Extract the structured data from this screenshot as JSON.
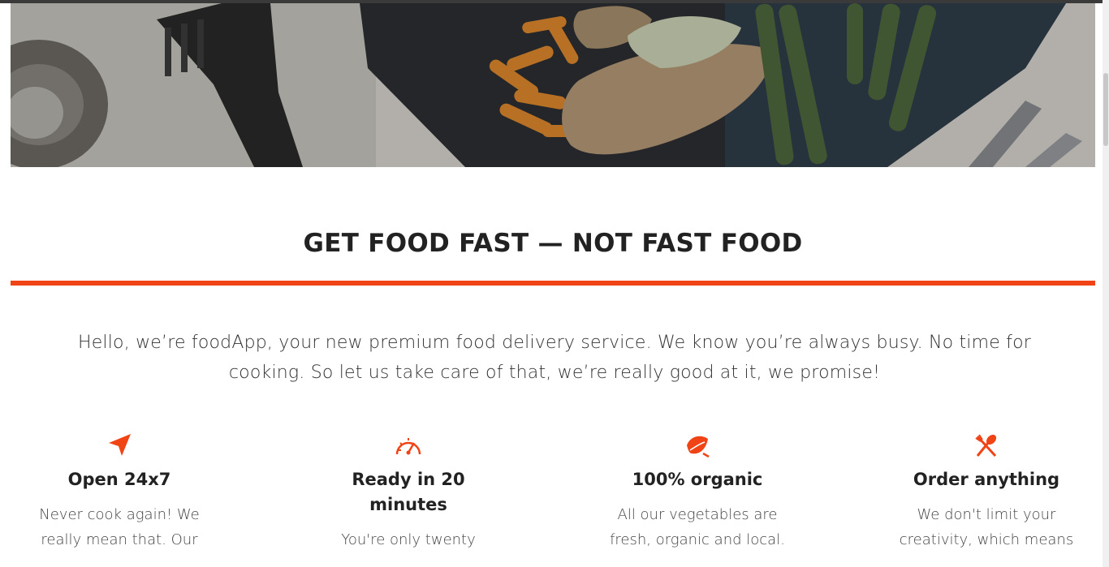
{
  "section": {
    "title": "GET FOOD FAST — NOT FAST FOOD",
    "intro": "Hello, we’re foodApp, your new premium food delivery service. We know you’re always busy. No time for cooking. So let us take care of that, we’re really good at it, we promise!"
  },
  "features": [
    {
      "icon": "navigate-arrow-icon",
      "title": "Open 24x7",
      "text": "Never cook again! We really mean that. Our"
    },
    {
      "icon": "speedometer-icon",
      "title": "Ready in 20 minutes",
      "text": "You're only twenty"
    },
    {
      "icon": "leaf-icon",
      "title": "100% organic",
      "text": "All our vegetables are fresh, organic and local."
    },
    {
      "icon": "fork-spoon-icon",
      "title": "Order anything",
      "text": "We don't limit your creativity, which means"
    }
  ],
  "colors": {
    "accent": "#f04416"
  }
}
